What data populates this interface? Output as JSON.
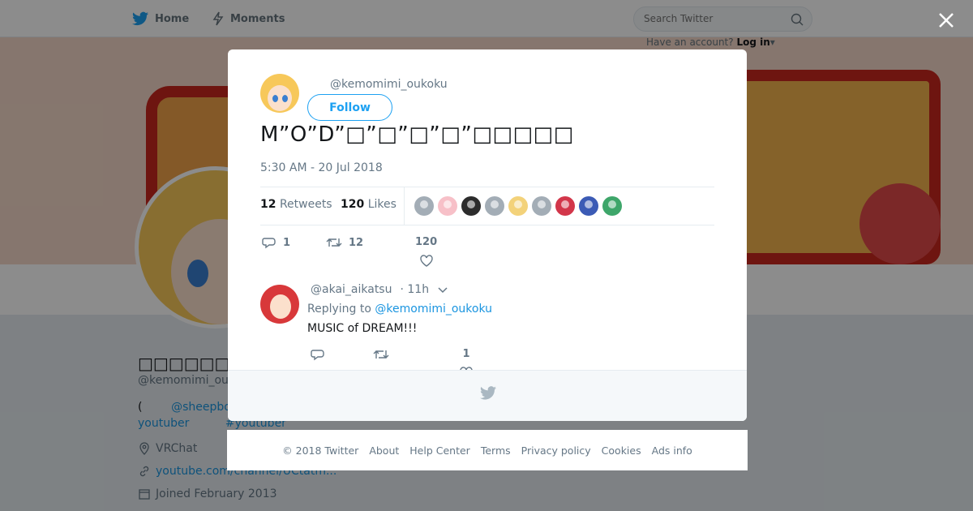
{
  "topnav": {
    "home_label": "Home",
    "moments_label": "Moments",
    "search_placeholder": "Search Twitter",
    "have_account_text": "Have an account?",
    "login_label": "Log in"
  },
  "profile": {
    "name": "□□□□□□□□□□",
    "handle": "@kemomimi_ou",
    "bio_line1_prefix": "(",
    "bio_line1_link": "@sheepbo",
    "bio_line2_link1": "youtuber",
    "bio_line2_link2": "#youtuber",
    "location": "VRChat",
    "website": "youtube.com/channel/UCtatm...",
    "joined": "Joined February 2013"
  },
  "tweet": {
    "handle": "@kemomimi_oukoku",
    "follow_label": "Follow",
    "text": "M”O”D”□”□”□”□”□□□□□",
    "timestamp": "5:30 AM - 20 Jul 2018",
    "retweets_count": "12",
    "retweets_label": "Retweets",
    "likes_count": "120",
    "likes_label": "Likes",
    "reply_count": "1",
    "retweet_action_count": "12",
    "like_action_count": "120"
  },
  "likers": [
    {
      "name": "liker-1",
      "color": "#a3adb6"
    },
    {
      "name": "liker-2",
      "color": "#f7c0c8"
    },
    {
      "name": "liker-3",
      "color": "#2c2c2c"
    },
    {
      "name": "liker-4",
      "color": "#a3adb6"
    },
    {
      "name": "liker-5",
      "color": "#f3d27a"
    },
    {
      "name": "liker-6",
      "color": "#a3adb6"
    },
    {
      "name": "liker-7",
      "color": "#d2364a"
    },
    {
      "name": "liker-8",
      "color": "#3b5bb5"
    },
    {
      "name": "liker-9",
      "color": "#3ea66a"
    }
  ],
  "reply": {
    "handle": "@akai_aikatsu",
    "time": "· 11h",
    "replying_prefix": "Replying to",
    "replying_to": "@kemomimi_oukoku",
    "text": "MUSIC of DREAM!!!",
    "like_count": "1"
  },
  "footer": {
    "links": [
      "© 2018 Twitter",
      "About",
      "Help Center",
      "Terms",
      "Privacy policy",
      "Cookies",
      "Ads info"
    ]
  },
  "colors": {
    "accent": "#1da1f2",
    "link": "#1b95e0",
    "muted": "#657786"
  }
}
